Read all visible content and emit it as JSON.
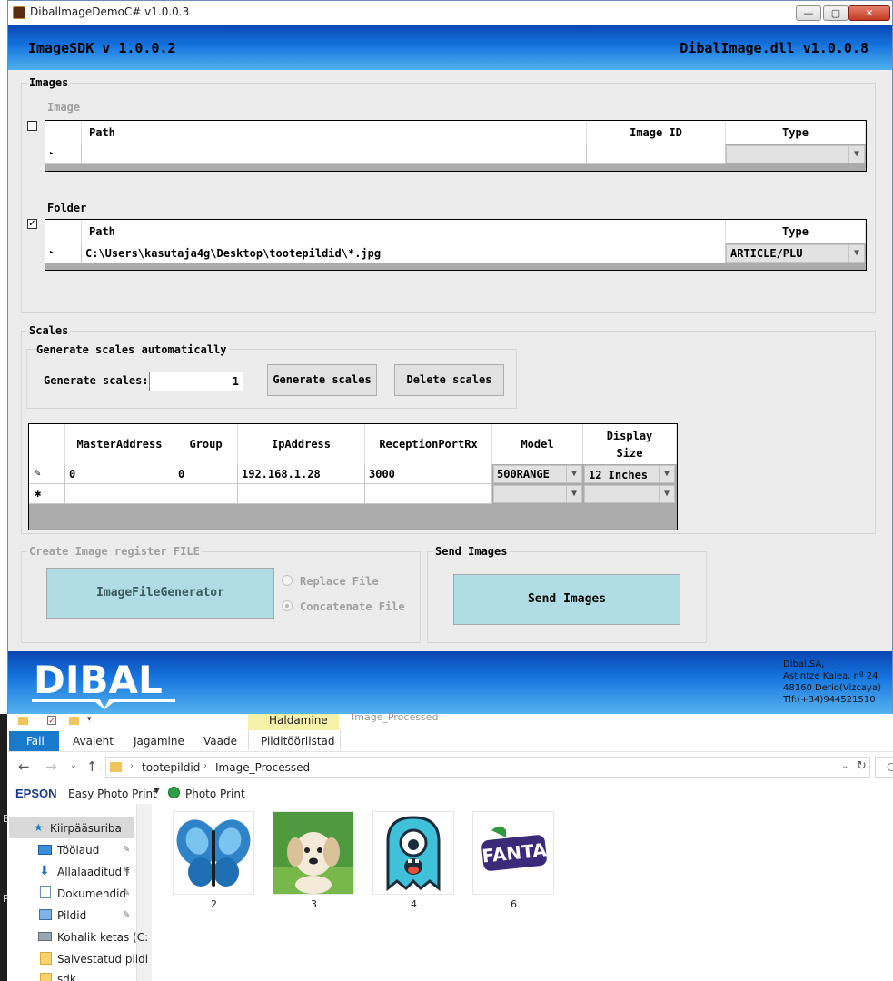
{
  "window": {
    "title": "DiballmageDemoC# v1.0.0.3",
    "min_glyph": "—",
    "max_glyph": "▢",
    "close_glyph": "✕"
  },
  "header": {
    "left": "ImageSDK v 1.0.0.2",
    "right": "DibalImage.dll v1.0.0.8"
  },
  "images": {
    "label": "Images",
    "image": {
      "label": "Image",
      "checked": false,
      "columns": [
        "Path",
        "Image ID",
        "Type"
      ],
      "row_marker": "▸"
    },
    "folder": {
      "label": "Folder",
      "checked": true,
      "check_glyph": "✓",
      "columns": [
        "Path",
        "Type"
      ],
      "row_marker": "▸",
      "path": "C:\\Users\\kasutaja4g\\Desktop\\tootepildid\\*.jpg",
      "type": "ARTICLE/PLU"
    }
  },
  "scales": {
    "label": "Scales",
    "auto_label": "Generate scales automatically",
    "generate_label": "Generate scales:",
    "generate_value": "1",
    "generate_button": "Generate scales",
    "delete_button": "Delete scales",
    "columns": [
      "MasterAddress",
      "Group",
      "IpAddress",
      "ReceptionPortRx",
      "Model",
      "Display Size"
    ],
    "edit_marker": "✎",
    "new_marker": "✱",
    "row": {
      "master": "0",
      "group": "0",
      "ip": "192.168.1.28",
      "port": "3000",
      "model": "500RANGE",
      "display": "12 Inches"
    }
  },
  "create_file": {
    "label": "Create Image register FILE",
    "generator_button": "ImageFileGenerator",
    "replace": "Replace File",
    "concatenate": "Concatenate File"
  },
  "send": {
    "label": "Send Images",
    "button": "Send Images"
  },
  "footer": {
    "logo": "DIBAL",
    "address": [
      "Dibal.SA,",
      "Astintze Kalea, nº 24",
      "48160 Derio(Vizcaya)",
      "Tlf:(+34)944521510"
    ]
  },
  "explorer": {
    "context_tab": "Haldamine",
    "title_text": "Image_Processed",
    "tabs": [
      "Fail",
      "Avaleht",
      "Jagamine",
      "Vaade",
      "Pilditööriistad"
    ],
    "breadcrumb": [
      "tootepildid",
      "Image_Processed"
    ],
    "epson_brand": "EPSON",
    "easy_photo_print": "Easy Photo Print",
    "photo_print": "Photo Print",
    "search_partial": "C",
    "side_letters": [
      "E",
      "P"
    ],
    "nav": [
      {
        "label": "Kiirpääsuriba",
        "icon": "star-icon"
      },
      {
        "label": "Töölaud",
        "icon": "desktop-icon"
      },
      {
        "label": "Allalaaditud f",
        "icon": "download-icon"
      },
      {
        "label": "Dokumendid",
        "icon": "documents-icon"
      },
      {
        "label": "Pildid",
        "icon": "pictures-icon"
      },
      {
        "label": "Kohalik ketas (C:",
        "icon": "drive-icon"
      },
      {
        "label": "Salvestatud pildi",
        "icon": "folder-icon"
      },
      {
        "label": "sdk",
        "icon": "folder-icon"
      }
    ],
    "files": [
      {
        "name": "2",
        "thumb": "butterfly"
      },
      {
        "name": "3",
        "thumb": "puppy"
      },
      {
        "name": "4",
        "thumb": "monster"
      },
      {
        "name": "6",
        "thumb": "fanta-logo"
      }
    ],
    "fanta_text": "FANTA"
  },
  "colors": {
    "header_dark": "#0a46b2",
    "header_light": "#52b0ef",
    "button_cyan": "#b0dde5",
    "explorer_selected": "#cce8ff"
  }
}
